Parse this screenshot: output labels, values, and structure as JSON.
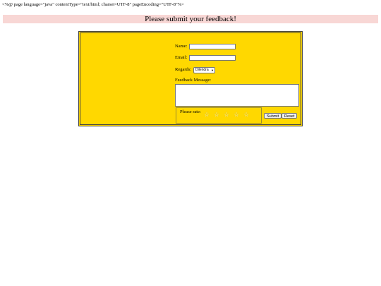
{
  "page": {
    "jsp_directive": "<%@ page language=\"java\" contentType=\"text/html; charset=UTF-8\" pageEncoding=\"UTF-8\"%>",
    "heading": "Please submit your feedback!"
  },
  "form": {
    "name_label": "Name:",
    "name_value": "",
    "email_label": "Email:",
    "email_value": "",
    "regards_label": "Regards:",
    "regards_selected": "Dilendra",
    "message_label": "Feedback Message:",
    "message_value": "",
    "rate_legend": "Please rate:",
    "rating": {
      "max": 5,
      "value": 0
    },
    "submit_label": "Submit",
    "reset_label": "Reset"
  },
  "colors": {
    "panel_bg": "#ffd800",
    "heading_bg": "#f8d7d5"
  }
}
